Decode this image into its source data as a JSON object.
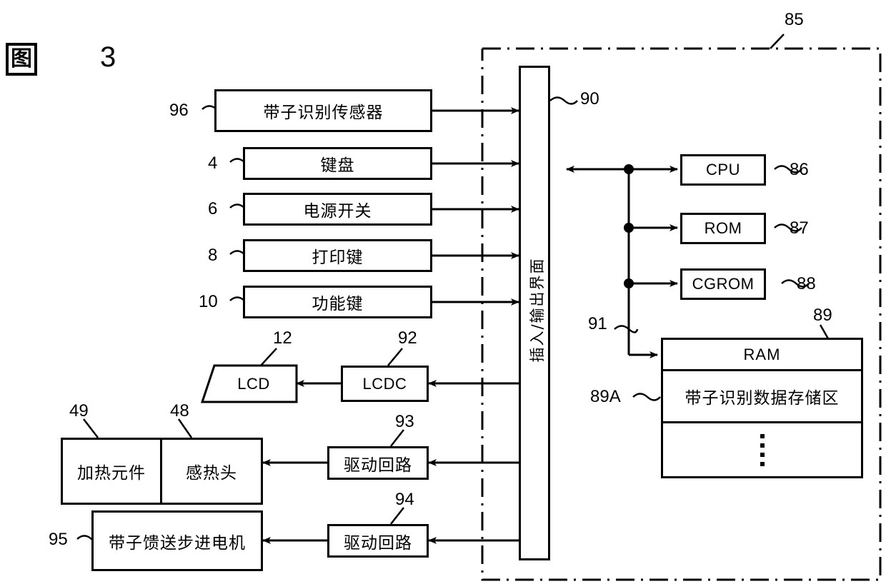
{
  "figure": {
    "label_box": "图",
    "number": "3"
  },
  "system_boundary": {
    "ref": "85"
  },
  "io_interface": {
    "label": "插入/输出界面",
    "ref": "90"
  },
  "bus": {
    "ref": "91"
  },
  "input_blocks": [
    {
      "label": "带子识别传感器",
      "ref": "96"
    },
    {
      "label": "键盘",
      "ref": "4"
    },
    {
      "label": "电源开关",
      "ref": "6"
    },
    {
      "label": "打印键",
      "ref": "8"
    },
    {
      "label": "功能键",
      "ref": "10"
    }
  ],
  "processor_blocks": [
    {
      "label": "CPU",
      "ref": "86"
    },
    {
      "label": "ROM",
      "ref": "87"
    },
    {
      "label": "CGROM",
      "ref": "88"
    }
  ],
  "ram": {
    "title": "RAM",
    "ref": "89",
    "region_label": "带子识别数据存储区",
    "region_ref": "89A"
  },
  "display": {
    "lcd": {
      "label": "LCD",
      "ref": "12"
    },
    "lcdc": {
      "label": "LCDC",
      "ref": "92"
    }
  },
  "print_head": {
    "heater": {
      "label": "加热元件",
      "ref": "49"
    },
    "thermal_head": {
      "label": "感热头",
      "ref": "48"
    },
    "driver": {
      "label": "驱动回路",
      "ref": "93"
    }
  },
  "tape_feed": {
    "motor": {
      "label": "带子馈送步进电机",
      "ref": "95"
    },
    "driver": {
      "label": "驱动回路",
      "ref": "94"
    }
  }
}
